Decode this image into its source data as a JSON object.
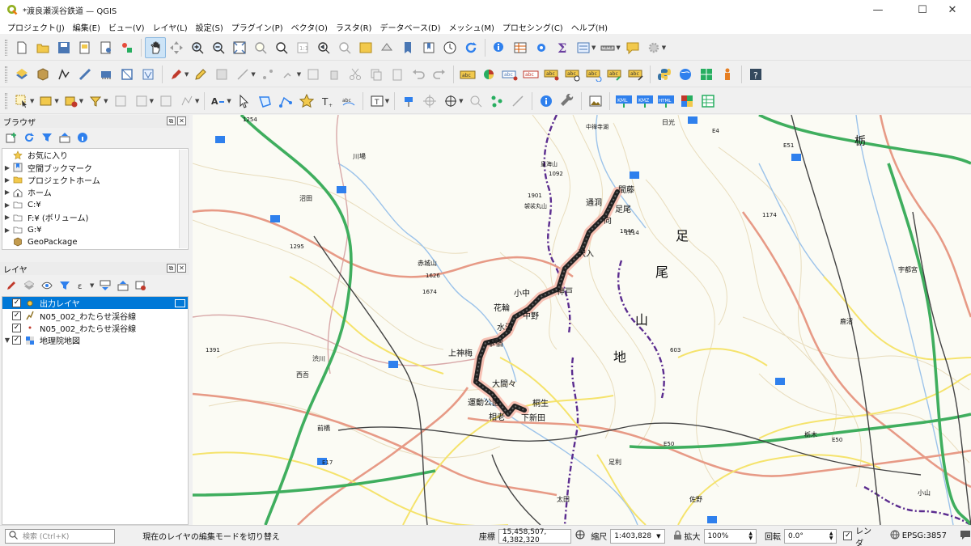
{
  "window": {
    "title": "*渡良瀬渓谷鉄道 — QGIS",
    "minimize": "—",
    "maximize": "☐",
    "close": "✕"
  },
  "menu": [
    "プロジェクト(J)",
    "編集(E)",
    "ビュー(V)",
    "レイヤ(L)",
    "設定(S)",
    "プラグイン(P)",
    "ベクタ(O)",
    "ラスタ(R)",
    "データベース(D)",
    "メッシュ(M)",
    "プロセシング(C)",
    "ヘルプ(H)"
  ],
  "browser": {
    "title": "ブラウザ",
    "items": [
      {
        "label": "お気に入り",
        "icon": "star-icon",
        "expand": ""
      },
      {
        "label": "空間ブックマーク",
        "icon": "bookmark-icon",
        "expand": "▶"
      },
      {
        "label": "プロジェクトホーム",
        "icon": "folder-icon",
        "expand": "▶"
      },
      {
        "label": "ホーム",
        "icon": "home-icon",
        "expand": "▶"
      },
      {
        "label": "C:¥",
        "icon": "folder-icon",
        "expand": "▶"
      },
      {
        "label": "F:¥ (ボリューム)",
        "icon": "folder-icon",
        "expand": "▶"
      },
      {
        "label": "G:¥",
        "icon": "folder-icon",
        "expand": "▶"
      },
      {
        "label": "GeoPackage",
        "icon": "geopackage-icon",
        "expand": ""
      }
    ]
  },
  "layers": {
    "title": "レイヤ",
    "items": [
      {
        "label": "出力レイヤ",
        "checked": "✓",
        "expand": "",
        "icon": "point-layer-icon",
        "selected": true
      },
      {
        "label": "N05_002_わたらせ渓谷線",
        "checked": "✓",
        "expand": "",
        "icon": "line-layer-icon",
        "selected": false
      },
      {
        "label": "N05_002_わたらせ渓谷線",
        "checked": "✓",
        "expand": "",
        "icon": "point-layer-small-icon",
        "selected": false
      },
      {
        "label": "地理院地図",
        "checked": "✓",
        "expand": "▼",
        "icon": "raster-layer-icon",
        "selected": false
      }
    ]
  },
  "map": {
    "labels": [
      "栃",
      "足",
      "尾",
      "山",
      "地",
      "足尾",
      "通洞",
      "間藤",
      "向",
      "小中",
      "花輪",
      "中野",
      "上神梅",
      "大間々",
      "運動公園",
      "桐生",
      "相老",
      "下新田",
      "沢入",
      "神戸",
      "水沼",
      "本宿",
      "1254",
      "1092",
      "1901",
      "1846",
      "1626",
      "1674",
      "1295",
      "1391",
      "1214",
      "603",
      "1174",
      "宇都宮",
      "足利",
      "太田",
      "小山",
      "佐野",
      "栃木",
      "前橋",
      "川場",
      "沼田",
      "西吾",
      "渋川",
      "赤城山",
      "中禅寺湖",
      "皇海山",
      "袈裟丸山",
      "日光",
      "鹿沼",
      "E4",
      "E17",
      "E50",
      "E51",
      "E50"
    ]
  },
  "status": {
    "search_placeholder": "検索 (Ctrl+K)",
    "message": "現在のレイヤの編集モードを切り替え",
    "coord_label": "座標",
    "coord_value": "15,458,507, 4,382,320",
    "scale_label": "縮尺",
    "scale_value": "1:403,828",
    "magnifier_label": "拡大",
    "magnifier_value": "100%",
    "rotation_label": "回転",
    "rotation_value": "0.0°",
    "render_label": "レンダ",
    "render_checked": "✓",
    "crs_label": "EPSG:3857"
  }
}
